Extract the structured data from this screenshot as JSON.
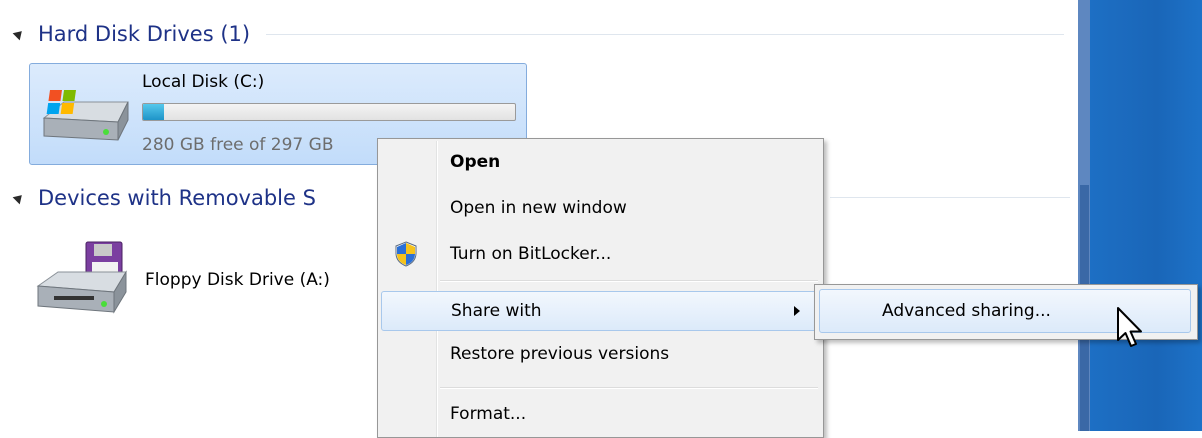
{
  "groups": {
    "hard_disk": {
      "label": "Hard Disk Drives (1)"
    },
    "removable": {
      "label": "Devices with Removable S"
    }
  },
  "local_disk": {
    "name": "Local Disk (C:)",
    "free_text": "280 GB free of 297 GB",
    "used_fraction": 0.057,
    "icon": "windows-hard-drive-icon"
  },
  "floppy": {
    "name": "Floppy Disk Drive (A:)",
    "icon": "floppy-drive-icon"
  },
  "partial_label": ":)",
  "context_menu": {
    "open": "Open",
    "open_new_window": "Open in new window",
    "bitlocker": "Turn on BitLocker...",
    "share_with": "Share with",
    "restore": "Restore previous versions",
    "format": "Format..."
  },
  "submenu": {
    "advanced_sharing": "Advanced sharing..."
  },
  "colors": {
    "group_header": "#1e3287",
    "selection": "#c2dcfa",
    "usage_fill": "#1e94c8",
    "desktop": "#1a66b8"
  }
}
